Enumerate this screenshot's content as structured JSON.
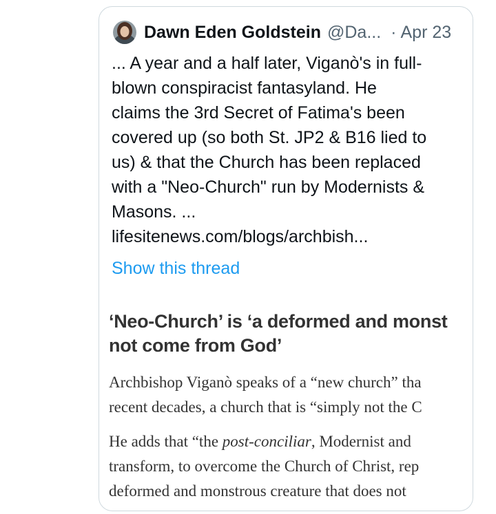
{
  "tweet": {
    "author_name": "Dawn Eden Goldstein",
    "author_handle": "@Da...",
    "separator": "·",
    "date": "Apr 23",
    "text_lines": [
      "... A year and a half later, Viganò's in full-",
      "blown conspiracist fantasyland. He",
      "claims the 3rd Secret of Fatima's been",
      "covered up (so both St. JP2 & B16 lied to",
      "us) & that the Church has been replaced",
      "with a \"Neo-Church\" run by Modernists &",
      "Masons. ...",
      "lifesitenews.com/blogs/archbish..."
    ],
    "show_thread": "Show this thread"
  },
  "quoted_article": {
    "headline_lines": [
      "‘Neo-Church’ is ‘a deformed and monst",
      "not come from God’"
    ],
    "paragraph1_lines": [
      "Archbishop Viganò speaks of a “new church” tha",
      "recent decades, a church that is “simply not the C"
    ],
    "paragraph2_line1_prefix": "He adds that “the ",
    "paragraph2_line1_italic": "post-conciliar",
    "paragraph2_line1_suffix": ", Modernist and",
    "paragraph2_lines_rest": [
      "transform, to overcome the Church of Christ, rep",
      "deformed and monstrous creature that does not"
    ]
  },
  "colors": {
    "link": "#1d9bf0",
    "text": "#0f1419",
    "secondary": "#536471",
    "border": "#cfd9de"
  }
}
